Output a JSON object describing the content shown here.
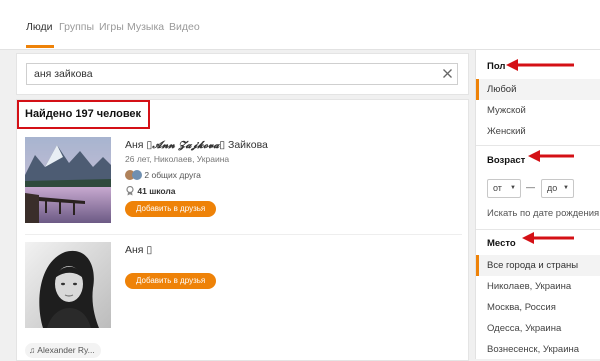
{
  "nav": {
    "tabs": [
      "Люди",
      "Группы",
      "Игры",
      "Музыка",
      "Видео"
    ]
  },
  "search": {
    "value": "аня зайкова",
    "clear_icon": "close-icon"
  },
  "results": {
    "found_label": "Найдено 197 человек",
    "people": [
      {
        "name_prefix": "Аня ▯",
        "name_styled": "𝓐𝓷𝓷 𝓩𝓪𝓳𝓴𝓸𝓿𝓪",
        "name_suffix": "▯ Зайкова",
        "meta": "26 лет, Николаев, Украина",
        "friends": "2 общих друга",
        "school": "41 школа",
        "add_label": "Добавить в друзья"
      },
      {
        "name": "Аня ▯",
        "add_label": "Добавить в друзья"
      }
    ],
    "music_chip": "Alexander Ry..."
  },
  "filters": {
    "gender": {
      "title": "Пол",
      "options": [
        "Любой",
        "Мужской",
        "Женский"
      ],
      "selected": "Любой"
    },
    "age": {
      "title": "Возраст",
      "from_label": "от",
      "dash": "—",
      "to_label": "до",
      "birthdate_link": "Искать по дате рождения"
    },
    "place": {
      "title": "Место",
      "options": [
        "Все города и страны",
        "Николаев, Украина",
        "Москва, Россия",
        "Одесса, Украина",
        "Вознесенск, Украина"
      ],
      "selected": "Все города и страны"
    }
  },
  "colors": {
    "accent": "#ee8208",
    "annotation_red": "#d41016"
  }
}
